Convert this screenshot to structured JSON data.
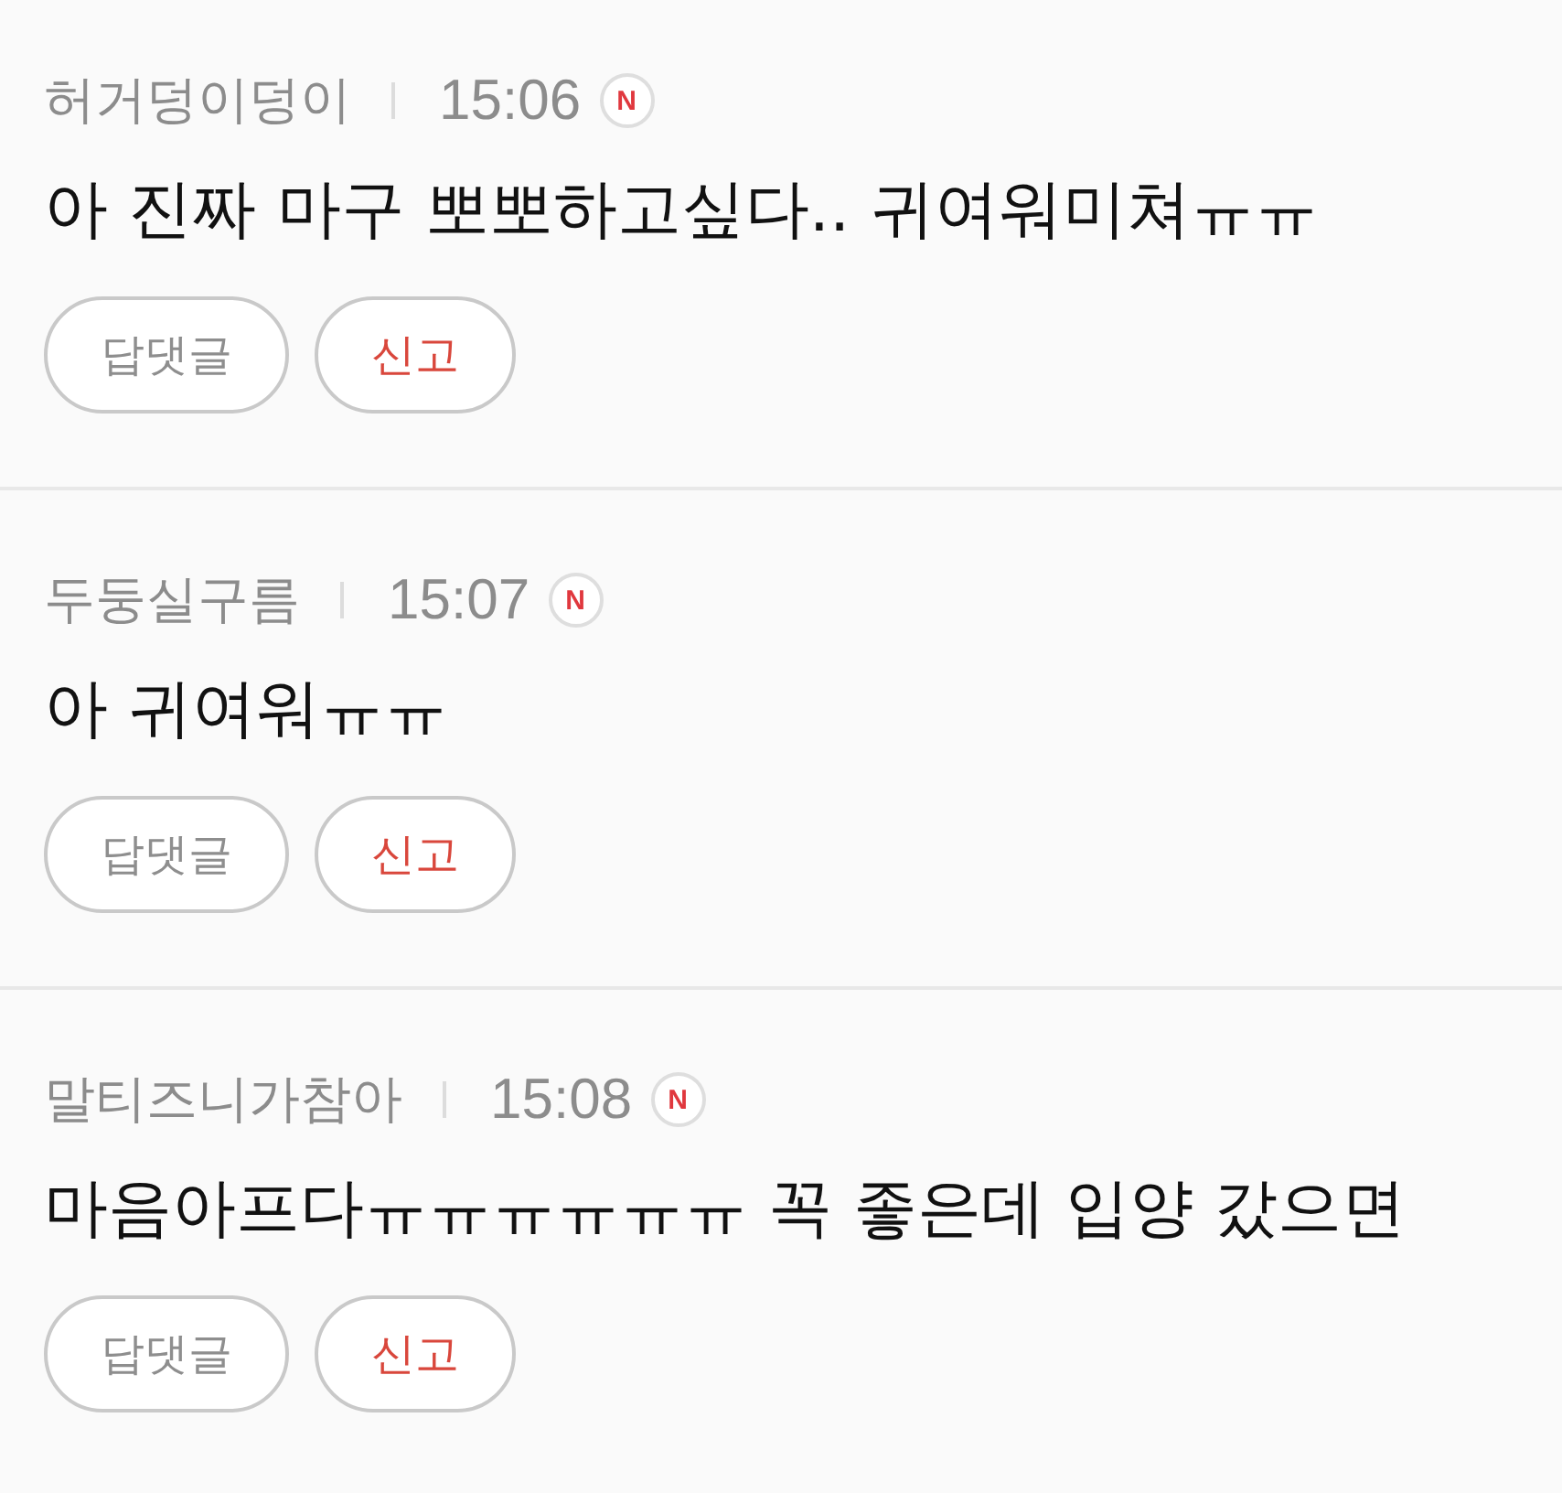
{
  "comments": [
    {
      "author": "허거덩이덩이",
      "time": "15:06",
      "badge": "N",
      "text": "아 진짜 마구 뽀뽀하고싶다.. 귀여워미쳐ㅠㅠ",
      "actions": [
        {
          "label": "답댓글",
          "kind": "reply"
        },
        {
          "label": "신고",
          "kind": "report"
        }
      ]
    },
    {
      "author": "두둥실구름",
      "time": "15:07",
      "badge": "N",
      "text": "아 귀여워ㅠㅠ",
      "actions": [
        {
          "label": "답댓글",
          "kind": "reply"
        },
        {
          "label": "신고",
          "kind": "report"
        }
      ]
    },
    {
      "author": "말티즈니가참아",
      "time": "15:08",
      "badge": "N",
      "text": "마음아프다ㅠㅠㅠㅠㅠㅠ 꼭 좋은데 입양 갔으면",
      "actions": [
        {
          "label": "답댓글",
          "kind": "reply"
        },
        {
          "label": "신고",
          "kind": "report"
        }
      ]
    }
  ]
}
